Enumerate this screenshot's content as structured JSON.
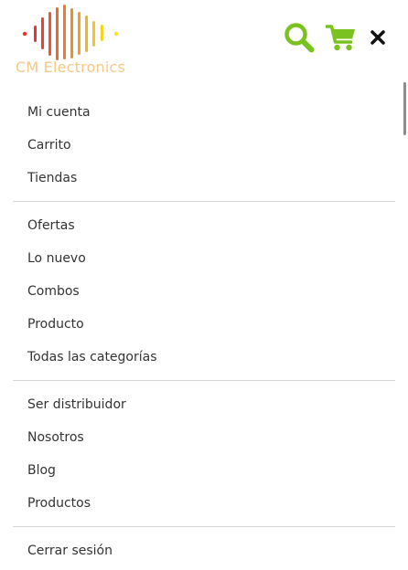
{
  "brand": {
    "name": "CM Electronics",
    "text_color": "#f4c98a",
    "logo_bar_colors": [
      "#e8352d",
      "#f0572c",
      "#f37a2a",
      "#f59d28",
      "#f7c326",
      "#f9e024"
    ]
  },
  "header": {
    "icon_color": "#7ac21f",
    "search_icon": "search-icon",
    "cart_icon": "cart-icon",
    "close_icon": "close-icon"
  },
  "menu": {
    "account_group": [
      {
        "label": "Mi cuenta"
      },
      {
        "label": "Carrito"
      },
      {
        "label": "Tiendas"
      }
    ],
    "shop_group": [
      {
        "label": "Ofertas"
      },
      {
        "label": "Lo nuevo"
      },
      {
        "label": "Combos"
      },
      {
        "label": "Producto"
      },
      {
        "label": "Todas las categorías"
      }
    ],
    "info_group": [
      {
        "label": "Ser distribuidor"
      },
      {
        "label": "Nosotros"
      },
      {
        "label": "Blog"
      },
      {
        "label": "Productos"
      }
    ],
    "session_group": [
      {
        "label": "Cerrar sesión"
      }
    ]
  }
}
